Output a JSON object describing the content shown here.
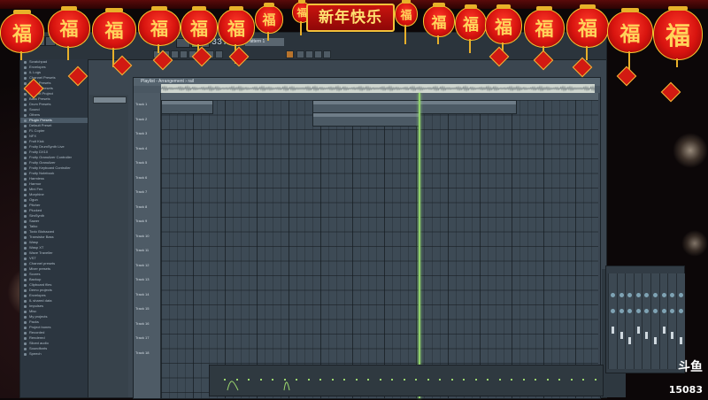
{
  "overlay": {
    "banner_text": "新年快乐",
    "lantern_char": "福",
    "platform_logo": "斗鱼",
    "room_number": "15083"
  },
  "topbar": {
    "tempo": "33:04",
    "pattern_name": "Pattern 1"
  },
  "browser": {
    "items": [
      "Scratchpad",
      "Envelopes",
      "IL Logs",
      "Channel Presets",
      "Mixer Presets",
      "Effects Presets",
      "Current Project",
      "Bass Presets",
      "Drum Presets",
      "Sound",
      "Others",
      "Plugin Presets",
      "Default Preset",
      "FL Copier",
      "NFX",
      "Fruit Kick",
      "Fruity DrumSynth Live",
      "Fruity DX10",
      "Fruity Granulizer Controller",
      "Fruity Granulizer",
      "Fruity Keyboard Controller",
      "Fruity Notebook",
      "Harmless",
      "Harmor",
      "Mini Fen",
      "Morphine",
      "Ogun",
      "Pitcher",
      "Plucked",
      "SimSynth",
      "Sawer",
      "Taiko",
      "Toxic Biohazard",
      "Transistor Bass",
      "Wasp",
      "Wasp XT",
      "Wave Traveller",
      "VST",
      "Channel presets",
      "Mixer presets",
      "Scores",
      "Backup",
      "Clipboard files",
      "Demo projects",
      "Envelopes",
      "IL shared data",
      "Impulses",
      "Misc",
      "My projects",
      "Packs",
      "Project bones",
      "Recorded",
      "Rendered",
      "Sliced audio",
      "Soundfonts",
      "Speech"
    ],
    "selected_index": 11
  },
  "playlist": {
    "title": "Playlist - Arrangement › rail",
    "tracks": [
      "Track 1",
      "Track 2",
      "Track 3",
      "Track 4",
      "Track 5",
      "Track 6",
      "Track 7",
      "Track 8",
      "Track 9",
      "Track 10",
      "Track 11",
      "Track 12",
      "Track 13",
      "Track 14",
      "Track 15",
      "Track 16",
      "Track 17",
      "Track 18"
    ],
    "playhead_progress": 0.59
  },
  "colors": {
    "playhead": "#8fd06a",
    "lantern_red": "#d8140f",
    "lantern_gold": "#f6c531",
    "daw_grid": "#3d4a55"
  }
}
